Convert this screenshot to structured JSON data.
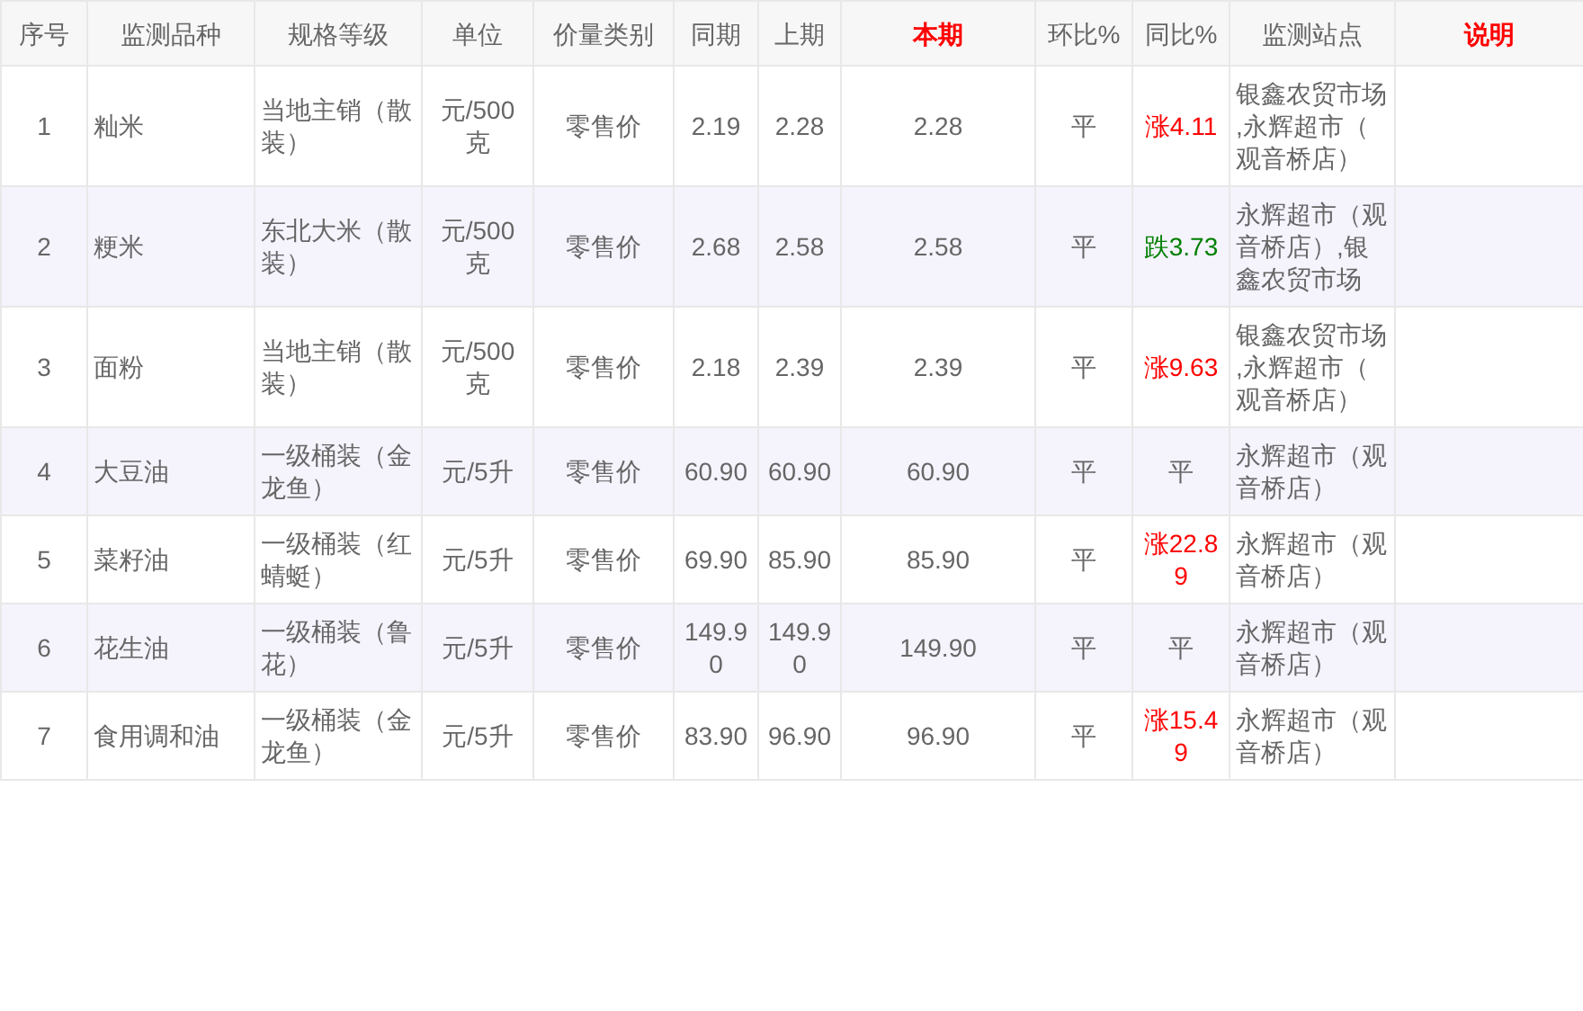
{
  "table": {
    "columns": [
      {
        "label": "序号",
        "highlight": false
      },
      {
        "label": "监测品种",
        "highlight": false
      },
      {
        "label": "规格等级",
        "highlight": false
      },
      {
        "label": "单位",
        "highlight": false
      },
      {
        "label": "价量类别",
        "highlight": false
      },
      {
        "label": "同期",
        "highlight": false
      },
      {
        "label": "上期",
        "highlight": false
      },
      {
        "label": "本期",
        "highlight": true
      },
      {
        "label": "环比%",
        "highlight": false
      },
      {
        "label": "同比%",
        "highlight": false
      },
      {
        "label": "监测站点",
        "highlight": false
      },
      {
        "label": "说明",
        "highlight": true
      }
    ],
    "rows": [
      {
        "no": "1",
        "item": "籼米",
        "spec": "当地主销（散装）",
        "unit": "元/500克",
        "price_type": "零售价",
        "same_period": "2.19",
        "last_period": "2.28",
        "current": "2.28",
        "mom": {
          "text": "平",
          "color": "#666666"
        },
        "yoy": {
          "text": "涨4.11",
          "color": "#ff0000"
        },
        "site": "银鑫农贸市场,永辉超市（观音桥店）"
      },
      {
        "no": "2",
        "item": "粳米",
        "spec": "东北大米（散装）",
        "unit": "元/500克",
        "price_type": "零售价",
        "same_period": "2.68",
        "last_period": "2.58",
        "current": "2.58",
        "mom": {
          "text": "平",
          "color": "#666666"
        },
        "yoy": {
          "text": "跌3.73",
          "color": "#008000"
        },
        "site": "永辉超市（观音桥店）,银鑫农贸市场"
      },
      {
        "no": "3",
        "item": "面粉",
        "spec": "当地主销（散装）",
        "unit": "元/500克",
        "price_type": "零售价",
        "same_period": "2.18",
        "last_period": "2.39",
        "current": "2.39",
        "mom": {
          "text": "平",
          "color": "#666666"
        },
        "yoy": {
          "text": "涨9.63",
          "color": "#ff0000"
        },
        "site": "银鑫农贸市场,永辉超市（观音桥店）"
      },
      {
        "no": "4",
        "item": "大豆油",
        "spec": "一级桶装（金龙鱼）",
        "unit": "元/5升",
        "price_type": "零售价",
        "same_period": "60.90",
        "last_period": "60.90",
        "current": "60.90",
        "mom": {
          "text": "平",
          "color": "#666666"
        },
        "yoy": {
          "text": "平",
          "color": "#666666"
        },
        "site": "永辉超市（观音桥店）"
      },
      {
        "no": "5",
        "item": "菜籽油",
        "spec": "一级桶装（红蜻蜓）",
        "unit": "元/5升",
        "price_type": "零售价",
        "same_period": "69.90",
        "last_period": "85.90",
        "current": "85.90",
        "mom": {
          "text": "平",
          "color": "#666666"
        },
        "yoy": {
          "text": "涨22.89",
          "color": "#ff0000"
        },
        "site": "永辉超市（观音桥店）"
      },
      {
        "no": "6",
        "item": "花生油",
        "spec": "一级桶装（鲁花）",
        "unit": "元/5升",
        "price_type": "零售价",
        "same_period": "149.90",
        "last_period": "149.90",
        "current": "149.90",
        "mom": {
          "text": "平",
          "color": "#666666"
        },
        "yoy": {
          "text": "平",
          "color": "#666666"
        },
        "site": "永辉超市（观音桥店）"
      },
      {
        "no": "7",
        "item": "食用调和油",
        "spec": "一级桶装（金龙鱼）",
        "unit": "元/5升",
        "price_type": "零售价",
        "same_period": "83.90",
        "last_period": "96.90",
        "current": "96.90",
        "mom": {
          "text": "平",
          "color": "#666666"
        },
        "yoy": {
          "text": "涨15.49",
          "color": "#ff0000"
        },
        "site": "永辉超市（观音桥店）"
      }
    ]
  }
}
